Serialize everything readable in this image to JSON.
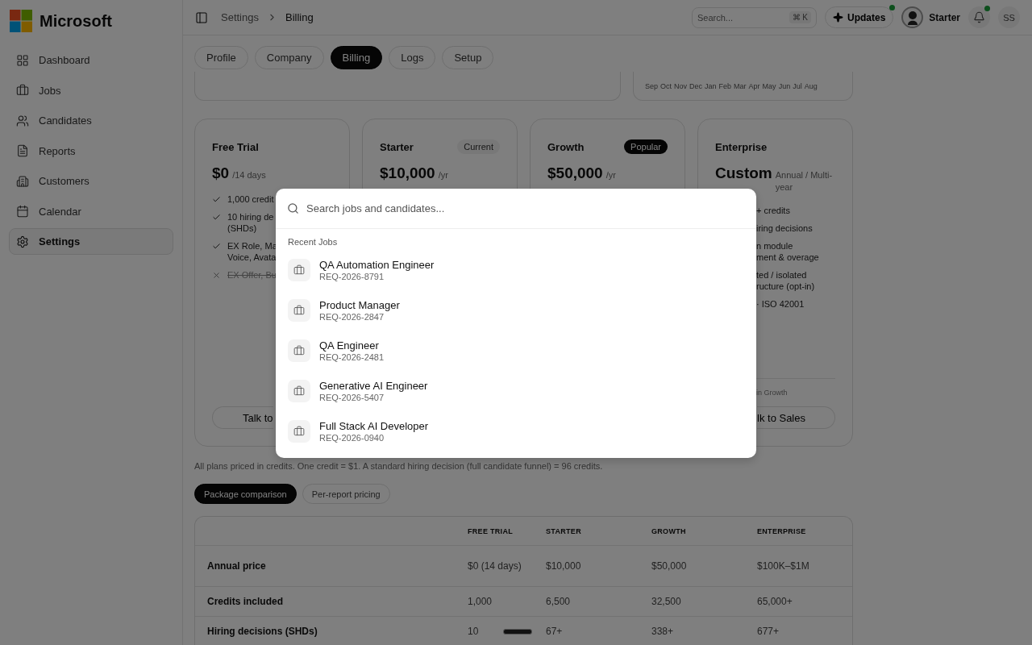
{
  "sidebar": {
    "brand": "Microsoft",
    "items": [
      {
        "label": "Dashboard",
        "selected": false
      },
      {
        "label": "Jobs",
        "selected": false
      },
      {
        "label": "Candidates",
        "selected": false
      },
      {
        "label": "Reports",
        "selected": false
      },
      {
        "label": "Customers",
        "selected": false
      },
      {
        "label": "Calendar",
        "selected": false
      },
      {
        "label": "Settings",
        "selected": true
      }
    ]
  },
  "header": {
    "breadcrumb": [
      "Settings",
      "Billing"
    ],
    "search": {
      "placeholder": "Search...",
      "shortcut": "⌘ K"
    },
    "updates": {
      "label": "Updates",
      "unread": true
    },
    "plan_label": "Starter",
    "notifications_unread": true,
    "initials": "SS"
  },
  "tabs": [
    {
      "label": "Profile",
      "selected": false
    },
    {
      "label": "Company",
      "selected": false
    },
    {
      "label": "Billing",
      "selected": true
    },
    {
      "label": "Logs",
      "selected": false
    },
    {
      "label": "Setup",
      "selected": false
    }
  ],
  "usage_card": {
    "months": [
      "Sep",
      "Oct",
      "Nov",
      "Dec",
      "Jan",
      "Feb",
      "Mar",
      "Apr",
      "May",
      "Jun",
      "Jul",
      "Aug"
    ]
  },
  "plans": [
    {
      "name": "Free Trial",
      "price": "$0",
      "period": "/14 days",
      "features": [
        {
          "lines": [
            "1,000 credit"
          ],
          "included": true
        },
        {
          "lines": [
            "10 hiring de",
            "(SHDs)"
          ],
          "included": true
        },
        {
          "lines": [
            "EX Role, Ma",
            "Voice, Avata"
          ],
          "included": true
        },
        {
          "lines": [
            "EX Offer, Bu"
          ],
          "included": false
        }
      ],
      "button": "Talk to"
    },
    {
      "name": "Starter",
      "badge": {
        "text": "Current",
        "kind": "current"
      },
      "price": "$10,000",
      "period": "/yr"
    },
    {
      "name": "Growth",
      "badge": {
        "text": "Popular",
        "kind": "popular"
      },
      "price": "$50,000",
      "period": "/yr"
    },
    {
      "name": "Enterprise",
      "price": "Custom",
      "period": "Annual / Multi-year",
      "features": [
        {
          "lines": [
            "+ credits"
          ]
        },
        {
          "lines": [
            "iring decisions"
          ]
        },
        {
          "lines": [
            "n module",
            "ment & overage"
          ]
        },
        {
          "lines": [
            "ted / isolated",
            "ructure (opt-in)"
          ]
        },
        {
          "lines": [
            "· ISO 42001"
          ]
        }
      ],
      "footnote": "in Growth",
      "button": "lk to Sales"
    }
  ],
  "pricing_note": "All plans priced in credits. One credit = $1. A standard hiring decision (full candidate funnel) = 96 credits.",
  "view_toggle": [
    {
      "label": "Package comparison",
      "selected": true
    },
    {
      "label": "Per-report pricing",
      "selected": false
    }
  ],
  "comparison_table": {
    "columns": [
      "",
      "FREE TRIAL",
      "STARTER",
      "GROWTH",
      "ENTERPRISE"
    ],
    "rows": [
      [
        "Annual price",
        "$0 (14 days)",
        "$10,000",
        "$50,000",
        "$100K–$1M"
      ],
      [
        "Credits included",
        "1,000",
        "6,500",
        "32,500",
        "65,000+"
      ],
      [
        "Hiring decisions (SHDs)",
        "10",
        "67+",
        "338+",
        "677+"
      ]
    ]
  },
  "search_dialog": {
    "placeholder": "Search jobs and candidates...",
    "section": "Recent Jobs",
    "results": [
      {
        "title": "QA Automation Engineer",
        "id": "REQ-2026-8791"
      },
      {
        "title": "Product Manager",
        "id": "REQ-2026-2847"
      },
      {
        "title": "QA Engineer",
        "id": "REQ-2026-2481"
      },
      {
        "title": "Generative AI Engineer",
        "id": "REQ-2026-5407"
      },
      {
        "title": "Full Stack AI Developer",
        "id": "REQ-2026-0940"
      }
    ]
  }
}
